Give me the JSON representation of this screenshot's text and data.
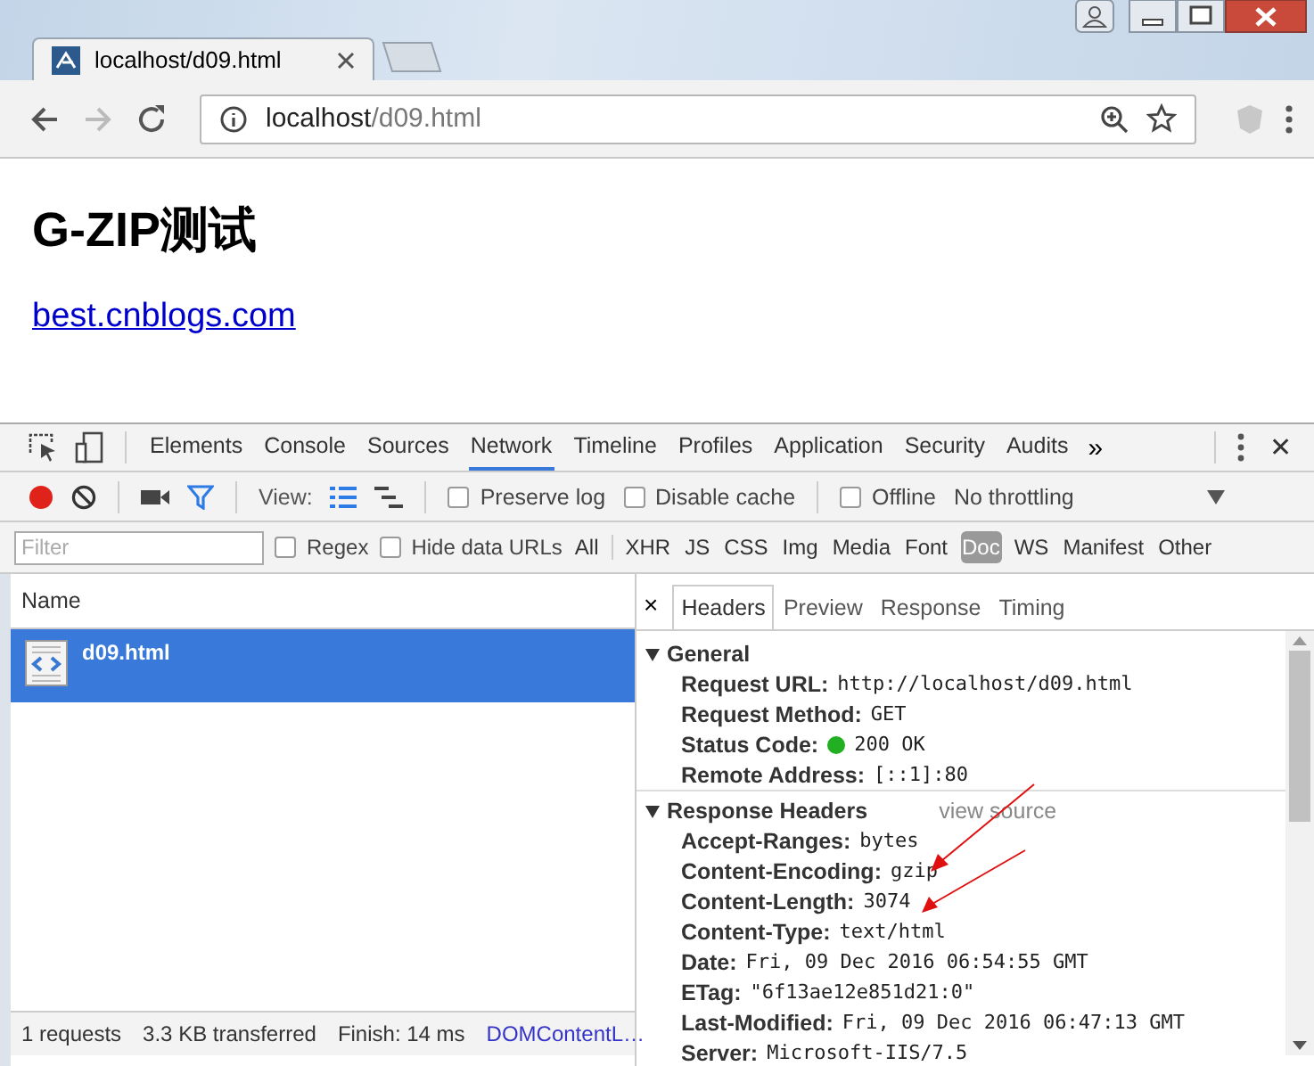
{
  "browser": {
    "tab_title": "localhost/d09.html",
    "url_host": "localhost",
    "url_path": "/d09.html"
  },
  "page": {
    "heading": "G-ZIP测试",
    "link": "best.cnblogs.com"
  },
  "devtools": {
    "panels": [
      {
        "label": "Elements",
        "selected": false
      },
      {
        "label": "Console",
        "selected": false
      },
      {
        "label": "Sources",
        "selected": false
      },
      {
        "label": "Network",
        "selected": true
      },
      {
        "label": "Timeline",
        "selected": false
      },
      {
        "label": "Profiles",
        "selected": false
      },
      {
        "label": "Application",
        "selected": false
      },
      {
        "label": "Security",
        "selected": false
      },
      {
        "label": "Audits",
        "selected": false
      }
    ],
    "more": "»",
    "close": "✕",
    "toolbar": {
      "recording": true,
      "filter_on": true,
      "view_label": "View:",
      "view_modes": [
        {
          "selected": true
        },
        {
          "selected": false
        }
      ],
      "options": [
        {
          "label": "Preserve log",
          "checked": false
        },
        {
          "label": "Disable cache",
          "checked": false
        },
        {
          "label": "Offline",
          "checked": false
        }
      ],
      "throttling": "No throttling"
    },
    "filter": {
      "placeholder": "Filter",
      "options": [
        {
          "label": "Regex",
          "checked": false
        },
        {
          "label": "Hide data URLs",
          "checked": false
        }
      ],
      "types": [
        {
          "label": "All",
          "selected": false
        },
        {
          "label": "XHR",
          "selected": false
        },
        {
          "label": "JS",
          "selected": false
        },
        {
          "label": "CSS",
          "selected": false
        },
        {
          "label": "Img",
          "selected": false
        },
        {
          "label": "Media",
          "selected": false
        },
        {
          "label": "Font",
          "selected": false
        },
        {
          "label": "Doc",
          "selected": true
        },
        {
          "label": "WS",
          "selected": false
        },
        {
          "label": "Manifest",
          "selected": false
        },
        {
          "label": "Other",
          "selected": false
        }
      ]
    },
    "requests": {
      "column": "Name",
      "rows": [
        {
          "name": "d09.html",
          "selected": true
        }
      ]
    },
    "status_bar": [
      {
        "text": "1 requests",
        "kind": "text"
      },
      {
        "text": "3.3 KB transferred",
        "kind": "text"
      },
      {
        "text": "Finish: 14 ms",
        "kind": "text"
      },
      {
        "text": "DOMContentL…",
        "kind": "link"
      }
    ],
    "detail": {
      "close": "×",
      "tabs": [
        {
          "label": "Headers",
          "selected": true
        },
        {
          "label": "Preview",
          "selected": false
        },
        {
          "label": "Response",
          "selected": false
        },
        {
          "label": "Timing",
          "selected": false
        }
      ],
      "sections": [
        {
          "title": "General",
          "expanded": true,
          "rows": [
            {
              "name": "Request URL:",
              "value": "http://localhost/d09.html",
              "kind": "plain"
            },
            {
              "name": "Request Method:",
              "value": "GET",
              "kind": "plain"
            },
            {
              "name": "Status Code:",
              "value": "200 OK",
              "kind": "status"
            },
            {
              "name": "Remote Address:",
              "value": "[::1]:80",
              "kind": "plain"
            }
          ]
        },
        {
          "title": "Response Headers",
          "expanded": true,
          "action": "view source",
          "rows": [
            {
              "name": "Accept-Ranges:",
              "value": "bytes",
              "kind": "plain"
            },
            {
              "name": "Content-Encoding:",
              "value": "gzip",
              "kind": "plain"
            },
            {
              "name": "Content-Length:",
              "value": "3074",
              "kind": "plain"
            },
            {
              "name": "Content-Type:",
              "value": "text/html",
              "kind": "plain"
            },
            {
              "name": "Date:",
              "value": "Fri, 09 Dec 2016 06:54:55 GMT",
              "kind": "plain"
            },
            {
              "name": "ETag:",
              "value": "\"6f13ae12e851d21:0\"",
              "kind": "plain"
            },
            {
              "name": "Last-Modified:",
              "value": "Fri, 09 Dec 2016 06:47:13 GMT",
              "kind": "plain"
            },
            {
              "name": "Server:",
              "value": "Microsoft-IIS/7.5",
              "kind": "plain"
            }
          ]
        }
      ]
    }
  }
}
